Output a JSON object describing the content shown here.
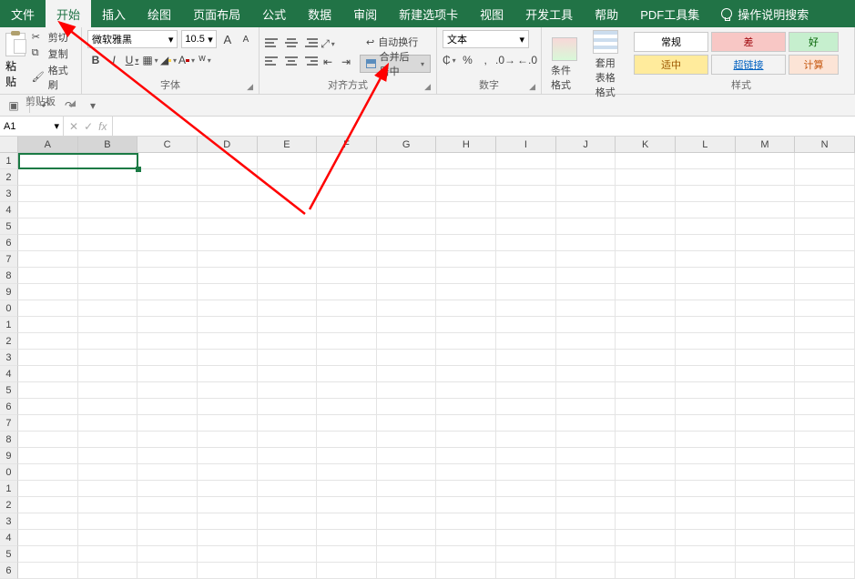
{
  "tabs": {
    "file": "文件",
    "home": "开始",
    "insert": "插入",
    "draw": "绘图",
    "pagelayout": "页面布局",
    "formulas": "公式",
    "data": "数据",
    "review": "审阅",
    "newtab": "新建选项卡",
    "view": "视图",
    "dev": "开发工具",
    "help": "帮助",
    "pdf": "PDF工具集",
    "search": "操作说明搜索"
  },
  "clipboard": {
    "paste": "粘贴",
    "cut": "剪切",
    "copy": "复制",
    "painter": "格式刷",
    "group": "剪贴板"
  },
  "font": {
    "name": "微软雅黑",
    "size": "10.5",
    "group": "字体",
    "bold": "B",
    "italic": "I",
    "underline": "U",
    "grow": "A",
    "shrink": "A"
  },
  "alignment": {
    "group": "对齐方式",
    "wrap": "自动换行",
    "merge": "合并后居中"
  },
  "number": {
    "format": "文本",
    "group": "数字",
    "currency": "₵",
    "percent": "%",
    "comma": ","
  },
  "styles": {
    "cond": "条件格式",
    "table": "套用\n表格格式",
    "group": "样式",
    "normal": "常规",
    "bad": "差",
    "good": "好",
    "neutral": "适中",
    "link": "超链接",
    "calc": "计算"
  },
  "namebox": "A1",
  "columns": [
    "A",
    "B",
    "C",
    "D",
    "E",
    "F",
    "G",
    "H",
    "I",
    "J",
    "K",
    "L",
    "M",
    "N"
  ],
  "rows": [
    "1",
    "2",
    "3",
    "4",
    "5",
    "6",
    "7",
    "8",
    "9",
    "0",
    "1",
    "2",
    "3",
    "4",
    "5",
    "6",
    "7",
    "8",
    "9",
    "0",
    "1",
    "2",
    "3",
    "4",
    "5",
    "6"
  ]
}
